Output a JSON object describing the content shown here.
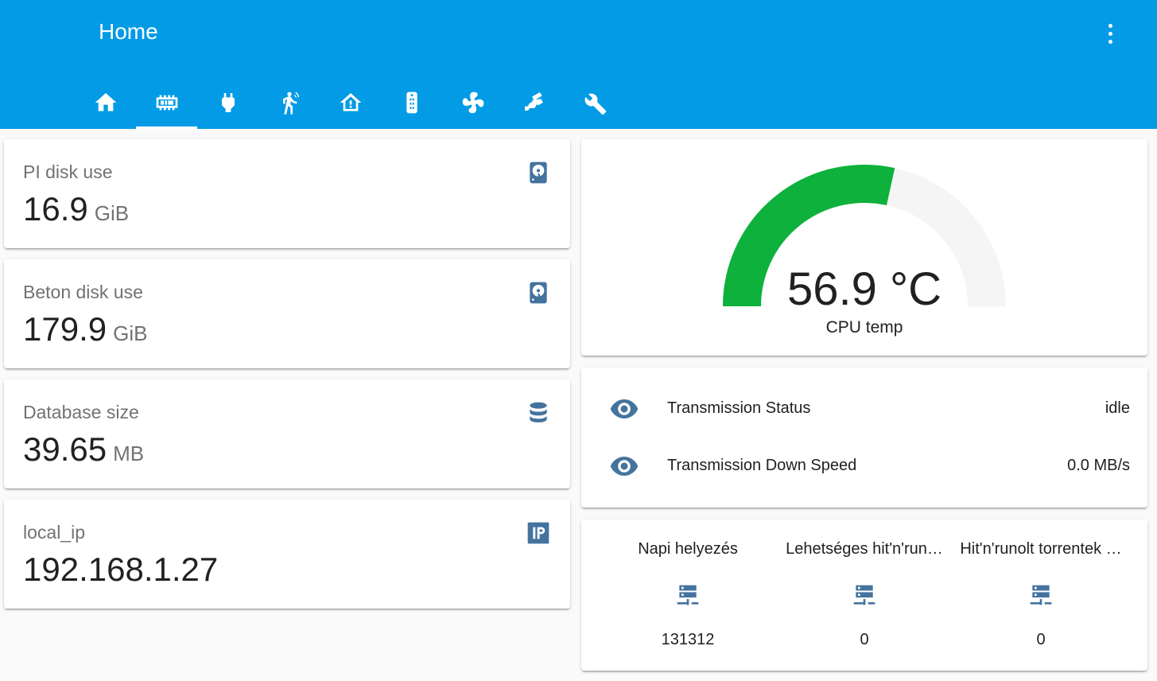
{
  "header": {
    "title": "Home",
    "menu_icon": "dots-vertical-icon",
    "tabs": [
      {
        "icon": "home-icon",
        "active": false
      },
      {
        "icon": "chip-icon",
        "active": true
      },
      {
        "icon": "power-plug-icon",
        "active": false
      },
      {
        "icon": "motion-sensor-icon",
        "active": false
      },
      {
        "icon": "home-alert-icon",
        "active": false
      },
      {
        "icon": "remote-icon",
        "active": false
      },
      {
        "icon": "air-conditioner-icon",
        "active": false
      },
      {
        "icon": "cctv-icon",
        "active": false
      },
      {
        "icon": "tools-icon",
        "active": false
      }
    ]
  },
  "sensors": [
    {
      "name": "PI disk use",
      "value": "16.9",
      "unit": "GiB",
      "icon": "harddisk-icon"
    },
    {
      "name": "Beton disk use",
      "value": "179.9",
      "unit": "GiB",
      "icon": "harddisk-icon"
    },
    {
      "name": "Database size",
      "value": "39.65",
      "unit": "MB",
      "icon": "database-icon"
    },
    {
      "name": "local_ip",
      "value": "192.168.1.27",
      "unit": "",
      "icon": "ip-icon"
    }
  ],
  "gauge": {
    "value_text": "56.9 °C",
    "name": "CPU temp",
    "fraction": 0.569,
    "color": "#0db13b",
    "track_color": "#f5f5f5"
  },
  "entities": [
    {
      "icon": "eye-icon",
      "name": "Transmission Status",
      "state": "idle"
    },
    {
      "icon": "eye-icon",
      "name": "Transmission Down Speed",
      "state": "0.0 MB/s"
    }
  ],
  "glance": [
    {
      "name": "Napi helyezés",
      "value": "131312",
      "icon": "server-network-icon"
    },
    {
      "name": "Lehetséges hit'n'run…",
      "value": "0",
      "icon": "server-network-icon"
    },
    {
      "name": "Hit'n'runolt torrentek …",
      "value": "0",
      "icon": "server-network-icon"
    }
  ],
  "colors": {
    "header": "#039be5",
    "icon": "#44739e",
    "background": "#fafafa"
  }
}
